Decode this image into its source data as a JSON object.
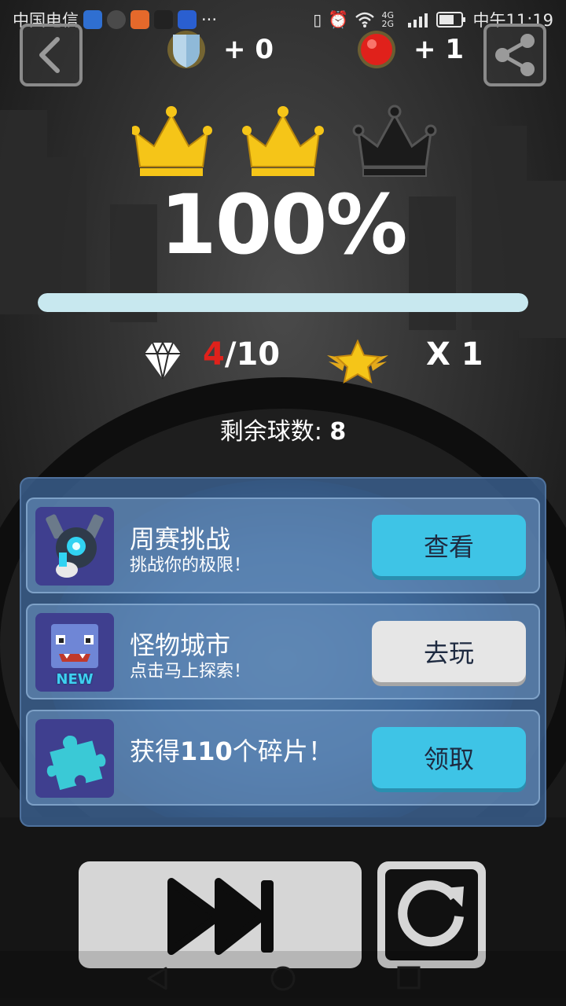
{
  "status_bar": {
    "carrier": "中国电信",
    "time": "中午11:19",
    "net": "4G 2G",
    "more": "···"
  },
  "rewards": {
    "shield_amount": "+ 0",
    "ball_amount": "+ 1"
  },
  "crowns": {
    "earned": 2,
    "total": 3
  },
  "result": {
    "percent_label": "100%",
    "progress_fraction": 1.0
  },
  "stats": {
    "gems_collected": "4",
    "gems_total": "/10",
    "stars_label": "X 1"
  },
  "remaining": {
    "label": "剩余球数:",
    "value": "8"
  },
  "offers": [
    {
      "title": "周赛挑战",
      "subtitle": "挑战你的极限！",
      "button": "查看",
      "button_style": "blue",
      "icon": "robot-character-icon"
    },
    {
      "title": "怪物城市",
      "subtitle": "点击马上探索！",
      "button": "去玩",
      "button_style": "gray",
      "icon": "monster-new-icon",
      "badge": "NEW"
    },
    {
      "title_prefix": "获得",
      "title_number": "110",
      "title_suffix": "个碎片！",
      "subtitle": "",
      "button": "领取",
      "button_style": "blue",
      "icon": "puzzle-piece-icon"
    }
  ],
  "colors": {
    "accent_blue": "#3ec4e6",
    "gold": "#f5c518",
    "highlight_red": "#e0211b"
  }
}
